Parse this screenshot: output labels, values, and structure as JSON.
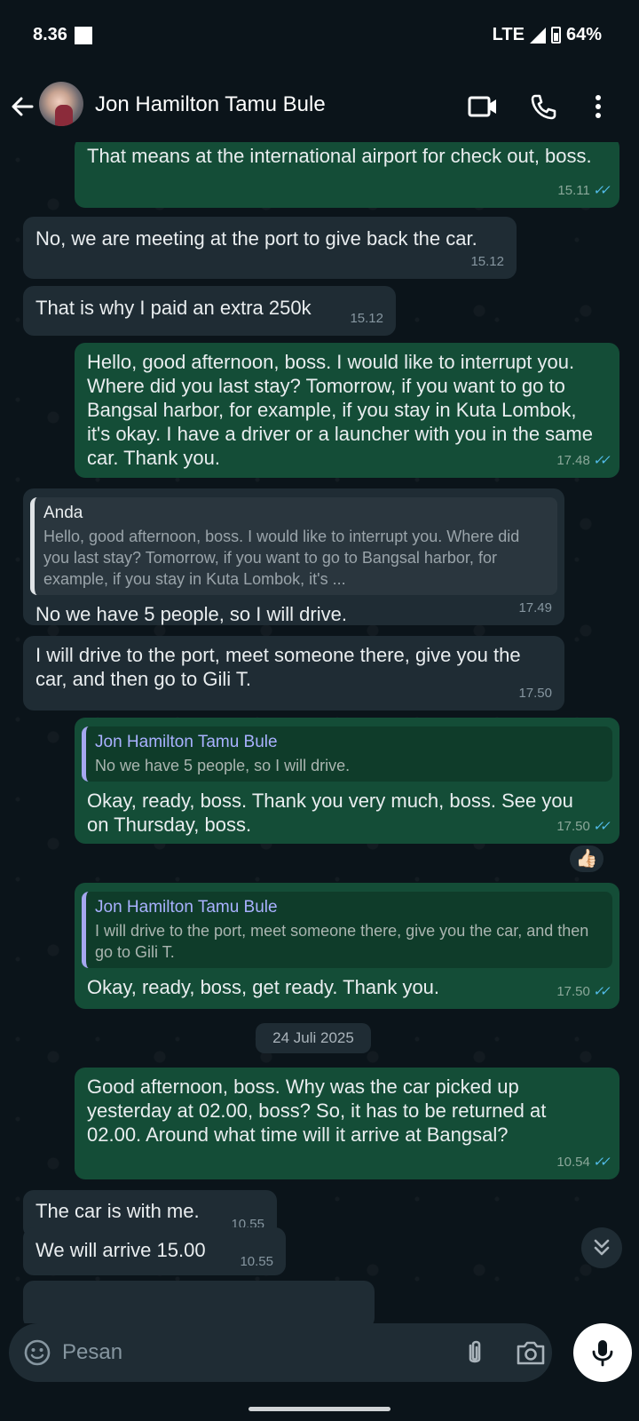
{
  "status_bar": {
    "time": "8.36",
    "network": "LTE",
    "battery": "64%"
  },
  "header": {
    "contact_name": "Jon Hamilton Tamu Bule"
  },
  "messages": [
    {
      "text": "That means at the international airport for check out, boss.",
      "time": "15.11"
    },
    {
      "text": "No, we are meeting at the port to give back the car.",
      "time": "15.12"
    },
    {
      "text": "That is why I paid an extra 250k",
      "time": "15.12"
    },
    {
      "text": "Hello, good afternoon, boss. I would like to interrupt you. Where did you last stay? Tomorrow, if you want to go to Bangsal harbor, for example, if you stay in Kuta Lombok, it's okay. I have a driver or a launcher with you in the same car. Thank you.",
      "time": "17.48"
    },
    {
      "quote_name": "Anda",
      "quote_text": "Hello, good afternoon, boss. I would like to interrupt you. Where did you last stay? Tomorrow, if you want to go to Bangsal harbor, for example, if you stay in Kuta Lombok, it's ...",
      "text": "No we have 5 people, so I will drive.",
      "time": "17.49"
    },
    {
      "text": "I will drive to the port, meet someone there, give you the car, and then go to Gili T.",
      "time": "17.50"
    },
    {
      "quote_name": "Jon Hamilton Tamu Bule",
      "quote_text": "No we have 5 people, so I will drive.",
      "text": "Okay, ready, boss. Thank you very much, boss. See you on Thursday, boss.",
      "time": "17.50",
      "reaction": "👍🏻"
    },
    {
      "quote_name": "Jon Hamilton Tamu Bule",
      "quote_text": "I will drive to the port, meet someone there, give you the car, and then go to Gili T.",
      "text": "Okay, ready, boss, get ready. Thank you.",
      "time": "17.50"
    },
    {
      "text": "Good afternoon, boss. Why was the car picked up yesterday at 02.00, boss? So, it has to be returned at 02.00. Around what time will it arrive at Bangsal?",
      "time": "10.54"
    },
    {
      "text": "The car is with me.",
      "time": "10.55"
    },
    {
      "text": "We will arrive 15.00",
      "time": "10.55"
    }
  ],
  "date_divider": "24 Juli 2025",
  "composer": {
    "placeholder": "Pesan"
  },
  "colors": {
    "outgoing_bubble": "#144d37",
    "incoming_bubble": "#1f2c34",
    "read_ticks": "#53bdeb",
    "background": "#0b141a"
  },
  "icons": [
    "back-arrow-icon",
    "video-call-icon",
    "phone-icon",
    "more-options-icon",
    "emoji-icon",
    "attach-icon",
    "camera-icon",
    "mic-icon",
    "scroll-down-icon"
  ]
}
